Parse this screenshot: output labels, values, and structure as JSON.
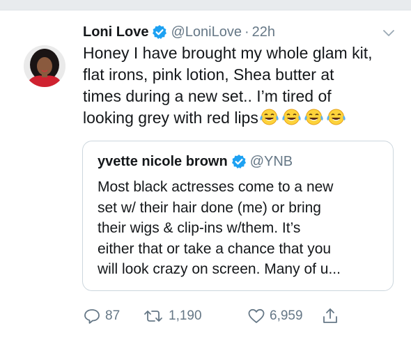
{
  "tweet": {
    "author_name": "Loni Love",
    "author_handle": "@LoniLove",
    "separator": "·",
    "time": "22h",
    "text": "Honey I have brought my whole glam kit,\nflat irons, pink lotion, Shea butter at\ntimes during a new set.. I’m tired of\nlooking grey with red lips",
    "emoji_count": 4,
    "emoji_name": "face-with-tears-of-joy"
  },
  "quoted": {
    "author_name": "yvette nicole brown",
    "author_handle": "@YNB",
    "text": "Most black actresses come to a new\nset w/ their hair done (me) or bring\ntheir wigs & clip-ins w/them. It’s\neither that or take a chance that you\nwill look crazy on screen. Many of u..."
  },
  "actions": {
    "replies": "87",
    "retweets": "1,190",
    "likes": "6,959"
  },
  "icons": {
    "reply": "reply-icon",
    "retweet": "retweet-icon",
    "like": "heart-icon",
    "share": "share-icon",
    "verified": "verified-badge-icon",
    "menu": "chevron-down-icon"
  },
  "colors": {
    "text": "#14171a",
    "secondary": "#657786",
    "verified": "#1da1f2",
    "border": "#ccd6dd"
  }
}
